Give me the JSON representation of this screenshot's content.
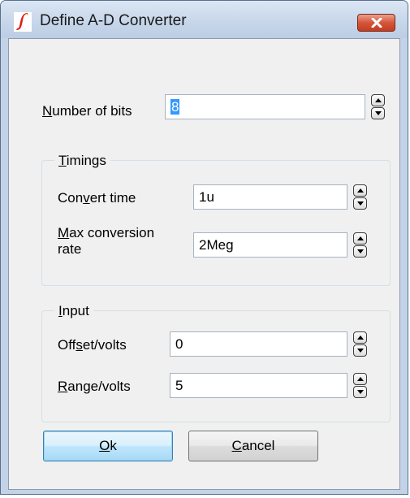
{
  "window": {
    "title": "Define A-D Converter",
    "close_icon": "close-icon"
  },
  "bits": {
    "label_underline": "N",
    "label_rest": "umber of bits",
    "value": "8"
  },
  "timings": {
    "group_title_underline": "T",
    "group_title_rest": "imings",
    "convert_time": {
      "label_pre": "Con",
      "label_underline": "v",
      "label_post": "ert time",
      "value": "1u"
    },
    "max_rate": {
      "label_underline": "M",
      "label_line1_rest": "ax conversion",
      "label_line2": "rate",
      "value": "2Meg"
    }
  },
  "input": {
    "group_title_underline": "I",
    "group_title_rest": "nput",
    "offset": {
      "label_pre": "Off",
      "label_underline": "s",
      "label_post": "et/volts",
      "value": "0"
    },
    "range": {
      "label_underline": "R",
      "label_rest": "ange/volts",
      "value": "5"
    }
  },
  "buttons": {
    "ok_underline": "O",
    "ok_rest": "k",
    "cancel_underline": "C",
    "cancel_rest": "ancel"
  },
  "colors": {
    "frame": "#c2d3e8",
    "client": "#f0f0f0",
    "close_red": "#d5553a",
    "default_button": "#bee6fd"
  }
}
